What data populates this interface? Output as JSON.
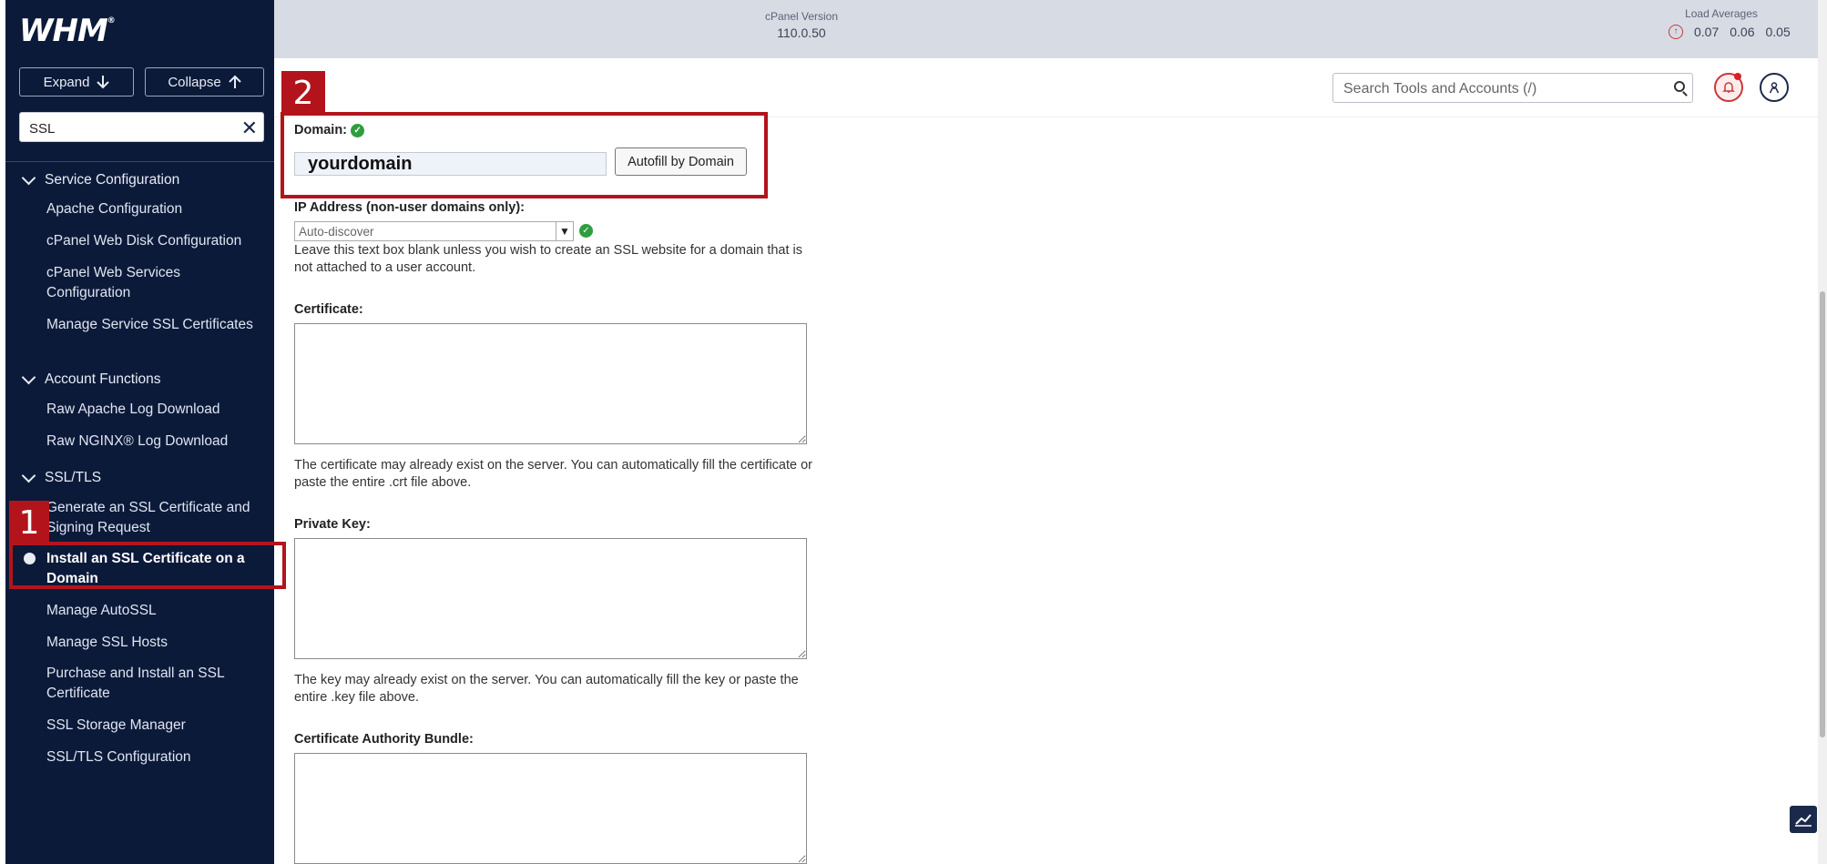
{
  "app": {
    "logo": "WHM",
    "logo_mark": "®"
  },
  "sidebar": {
    "expand_label": "Expand",
    "collapse_label": "Collapse",
    "search_value": "SSL",
    "sections": [
      {
        "label": "Service Configuration",
        "items": [
          "Apache Configuration",
          "cPanel Web Disk Configuration",
          "cPanel Web Services Configuration",
          "Manage Service SSL Certificates"
        ]
      },
      {
        "label": "Account Functions",
        "items": [
          "Raw Apache Log Download",
          "Raw NGINX® Log Download"
        ]
      },
      {
        "label": "SSL/TLS",
        "items": [
          "Generate an SSL Certificate and Signing Request",
          "Install an SSL Certificate on a Domain",
          "Manage AutoSSL",
          "Manage SSL Hosts",
          "Purchase and Install an SSL Certificate",
          "SSL Storage Manager",
          "SSL/TLS Configuration"
        ]
      }
    ]
  },
  "topbar": {
    "version_label": "cPanel Version",
    "version_value": "110.0.50",
    "load_label": "Load Averages",
    "load_values": [
      "0.07",
      "0.06",
      "0.05"
    ]
  },
  "header": {
    "search_placeholder": "Search Tools and Accounts (/)"
  },
  "form": {
    "domain_label": "Domain:",
    "domain_value": "yourdomain",
    "autofill_label": "Autofill by Domain",
    "ip_label": "IP Address (non-user domains only):",
    "ip_value": "Auto-discover",
    "ip_help": "Leave this text box blank unless you wish to create an SSL website for a domain that is not attached to a user account.",
    "cert_label": "Certificate:",
    "cert_help": "The certificate may already exist on the server. You can automatically fill the certificate or paste the entire .crt file above.",
    "key_label": "Private Key:",
    "key_help": "The key may already exist on the server. You can automatically fill the key or paste the entire .key file above.",
    "cab_label": "Certificate Authority Bundle:"
  },
  "annotations": [
    "1",
    "2"
  ],
  "colors": {
    "sidebar_bg": "#0c1a3a",
    "topbar_bg": "#d7dbe3",
    "annotation": "#b3141c",
    "ok_green": "#2e9e3e"
  }
}
